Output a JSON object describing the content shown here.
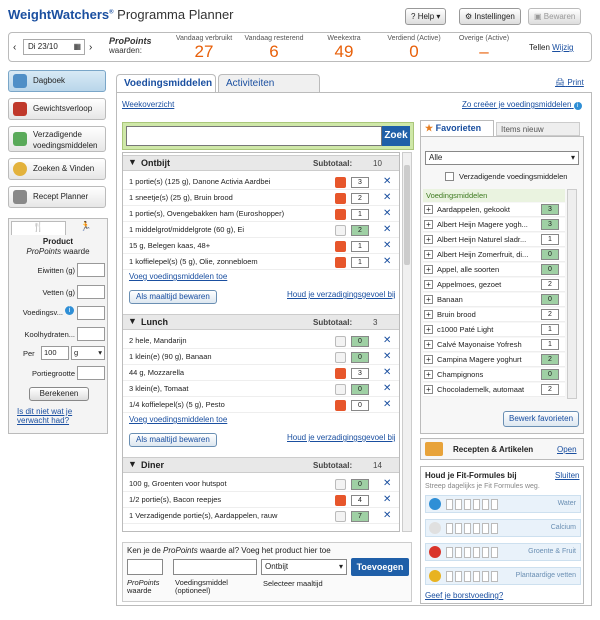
{
  "header": {
    "brand": "WeightWatchers",
    "reg": "®",
    "app": "Programma Planner",
    "help": "Help",
    "settings": "Instellingen",
    "save": "Bewaren"
  },
  "stats": {
    "date": "Di 23/10",
    "pp_title": "ProPoints",
    "pp_sub": "waarden:",
    "used_label": "Vandaag verbruikt",
    "used": "27",
    "rem_label": "Vandaag resterend",
    "rem": "6",
    "week_label": "Weekextra",
    "week": "49",
    "earned_label": "Verdiend (Active)",
    "earned": "0",
    "other_label": "Overige (Active)",
    "other": "–",
    "count_label": "Tellen",
    "change": "Wijzig"
  },
  "sidebar": {
    "items": [
      {
        "label": "Dagboek"
      },
      {
        "label": "Gewichtsverloop"
      },
      {
        "label": "Verzadigende voedingsmiddelen"
      },
      {
        "label": "Zoeken & Vinden"
      },
      {
        "label": "Recept Planner"
      }
    ],
    "calc_title": "Product",
    "calc_pp": "ProPoints",
    "calc_waarde": "waarde",
    "fields": [
      "Eiwitten (g)",
      "Vetten (g)",
      "Voedingsv...",
      "Koolhydraten..."
    ],
    "per": "Per",
    "per_val": "100",
    "unit": "g",
    "portie": "Portiegrootte",
    "calc_btn": "Berekenen",
    "help_link": "Is dit niet wat je verwacht had?"
  },
  "tabs": {
    "food": "Voedingsmiddelen",
    "act": "Activiteiten"
  },
  "print": "Print",
  "weekoverzicht": "Weekoverzicht",
  "create": "Zo creëer je voedingsmiddelen",
  "search_btn": "Zoek",
  "meals": [
    {
      "title": "Ontbijt",
      "subtotal_label": "Subtotaal:",
      "subtotal": "10",
      "rows": [
        {
          "t": "1 portie(s) (125 g), Danone Activia Aardbei",
          "v": "3",
          "g": false
        },
        {
          "t": "1 sneetje(s) (25 g), Bruin brood",
          "v": "2",
          "g": false
        },
        {
          "t": "1 portie(s), Ovengebakken ham (Euroshopper)",
          "v": "1",
          "g": false
        },
        {
          "t": "1 middelgrot/middelgrote (60 g), Ei",
          "v": "2",
          "g": true
        },
        {
          "t": "15 g, Belegen kaas, 48+",
          "v": "1",
          "g": false
        },
        {
          "t": "1 koffielepel(s) (5 g), Olie, zonnebloem",
          "v": "1",
          "g": false
        }
      ],
      "add": "Voeg voedingsmiddelen toe",
      "save": "Als maaltijd bewaren",
      "track": "Houd je verzadigingsgevoel bij"
    },
    {
      "title": "Lunch",
      "subtotal_label": "Subtotaal:",
      "subtotal": "3",
      "rows": [
        {
          "t": "2 hele, Mandarijn",
          "v": "0",
          "g": true
        },
        {
          "t": "1 klein(e) (90 g), Banaan",
          "v": "0",
          "g": true
        },
        {
          "t": "44 g, Mozzarella",
          "v": "3",
          "g": false
        },
        {
          "t": "3 klein(e), Tomaat",
          "v": "0",
          "g": true
        },
        {
          "t": "1/4 koffielepel(s) (5 g), Pesto",
          "v": "0",
          "g": false
        }
      ],
      "add": "Voeg voedingsmiddelen toe",
      "save": "Als maaltijd bewaren",
      "track": "Houd je verzadigingsgevoel bij"
    },
    {
      "title": "Diner",
      "subtotal_label": "Subtotaal:",
      "subtotal": "14",
      "rows": [
        {
          "t": "100 g, Groenten voor hutspot",
          "v": "0",
          "g": true
        },
        {
          "t": "1/2 portie(s), Bacon reepjes",
          "v": "4",
          "g": false
        },
        {
          "t": "1 Verzadigende portie(s), Aardappelen, rauw",
          "v": "7",
          "g": true
        }
      ]
    }
  ],
  "quick": {
    "q1": "Ken je de ",
    "q2": "ProPoints",
    "q3": " waarde al? Voeg het product hier toe",
    "pp": "ProPoints",
    "waarde": "waarde",
    "food": "Voedingsmiddel",
    "opt": "(optioneel)",
    "meal_val": "Ontbijt",
    "meal_label": "Selecteer maaltijd",
    "add": "Toevoegen"
  },
  "fav": {
    "tab1": "Favorieten",
    "tab2": "Items nieuw",
    "filter": "Alle",
    "check": "Verzadigende voedingsmiddelen",
    "head": "Voedingsmiddelen",
    "items": [
      {
        "t": "Aardappelen, gekookt",
        "v": "3",
        "g": true
      },
      {
        "t": "Albert Heijn Magere yogh...",
        "v": "3",
        "g": true
      },
      {
        "t": "Albert Heijn Naturel sladr...",
        "v": "1",
        "g": false
      },
      {
        "t": "Albert Heijn Zomerfruit, di...",
        "v": "0",
        "g": true
      },
      {
        "t": "Appel, alle soorten",
        "v": "0",
        "g": true
      },
      {
        "t": "Appelmoes, gezoet",
        "v": "2",
        "g": false
      },
      {
        "t": "Banaan",
        "v": "0",
        "g": true
      },
      {
        "t": "Bruin brood",
        "v": "2",
        "g": false
      },
      {
        "t": "c1000 Paté Light",
        "v": "1",
        "g": false
      },
      {
        "t": "Calvé Mayonaise Yofresh",
        "v": "1",
        "g": false
      },
      {
        "t": "Campina Magere yoghurt",
        "v": "2",
        "g": true
      },
      {
        "t": "Champignons",
        "v": "0",
        "g": true
      },
      {
        "t": "Chocolademelk, automaat",
        "v": "2",
        "g": false
      }
    ],
    "edit": "Bewerk favorieten"
  },
  "recipes": {
    "label": "Recepten & Artikelen",
    "open": "Open"
  },
  "fit": {
    "title": "Houd je Fit-Formules bij",
    "close": "Sluiten",
    "sub": "Streep dagelijks je Fit Formules weg.",
    "items": [
      "Water",
      "Calcium",
      "Groente & Fruit",
      "Plantaardige vetten"
    ],
    "link": "Geef je borstvoeding?"
  }
}
